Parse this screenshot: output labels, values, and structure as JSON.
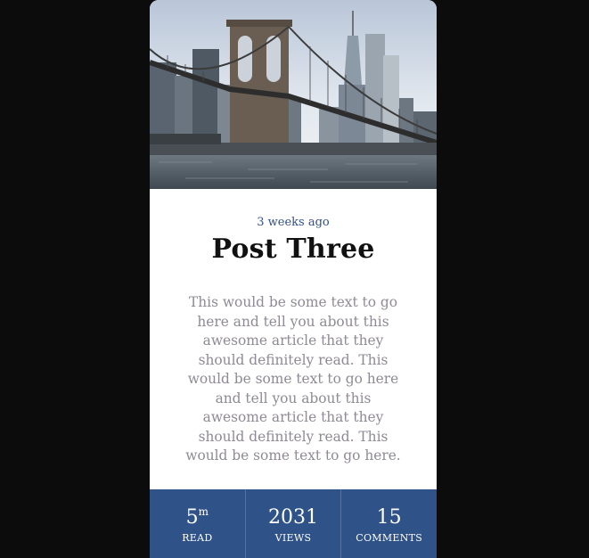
{
  "card": {
    "image": {
      "name": "brooklyn-bridge-photo"
    },
    "timestamp": "3 weeks ago",
    "title": "Post Three",
    "excerpt": "This would be some text to go here and tell you about this awesome article that they should definitely read. This would be some text to go here and tell you about this awesome article that they should definitely read. This would be some text to go here.",
    "stats": [
      {
        "value": "5",
        "suffix": "m",
        "label": "READ"
      },
      {
        "value": "2031",
        "suffix": "",
        "label": "VIEWS"
      },
      {
        "value": "15",
        "suffix": "",
        "label": "COMMENTS"
      }
    ]
  },
  "colors": {
    "page_background": "#0c0c0c",
    "accent": "#2f5288",
    "timestamp": "#2e5189",
    "excerpt": "#8f8a95"
  }
}
